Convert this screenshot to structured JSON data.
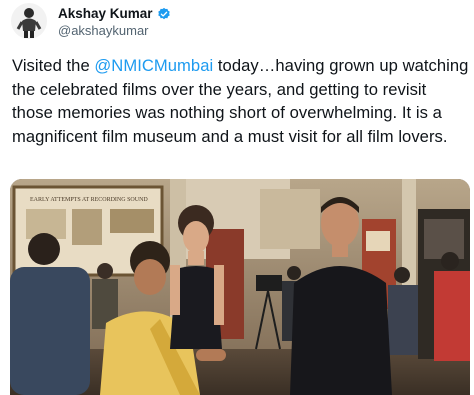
{
  "author": {
    "display_name": "Akshay Kumar",
    "handle": "@akshaykumar",
    "verified": true,
    "avatar_icon": "profile-photo",
    "verified_icon": "verified-badge-icon"
  },
  "tweet": {
    "text_before_mention": "Visited the ",
    "mention": "@NMICMumbai",
    "text_after_mention": " today…having grown up watching the celebrated films over the years, and getting to revisit those memories was nothing short of overwhelming. It is a magnificent film museum and a must visit for all film lovers."
  },
  "media": {
    "poster_text": "EARLY ATTEMPTS AT RECORDING SOUND"
  },
  "colors": {
    "link": "#1d9bf0",
    "verified": "#1d9bf0",
    "text": "#0f1419",
    "secondary": "#536471"
  }
}
